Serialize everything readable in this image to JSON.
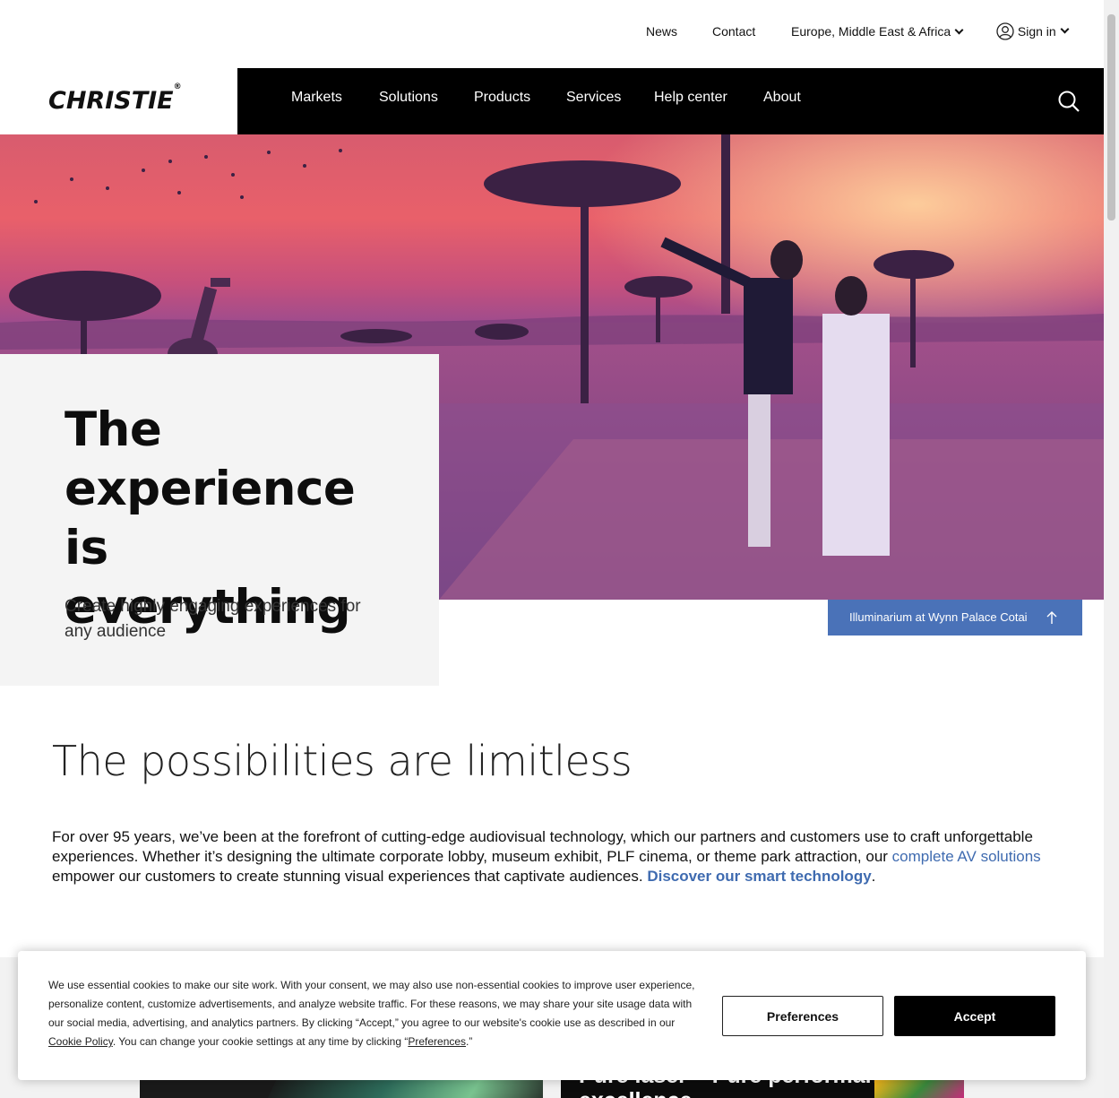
{
  "utility": {
    "news": "News",
    "contact": "Contact",
    "region": "Europe, Middle East & Africa",
    "signin": "Sign in"
  },
  "brand": {
    "logo": "CHRISTIE",
    "reg": "®"
  },
  "nav": {
    "items": [
      "Markets",
      "Solutions",
      "Products",
      "Services",
      "Help center",
      "About"
    ]
  },
  "hero": {
    "title": "The experience is everything",
    "subtitle": "Create highly engaging experiences for any audience",
    "caption": "Illuminarium at Wynn Palace Cotai"
  },
  "intro": {
    "title": "The possibilities are limitless",
    "p1": "For over 95 years, we’ve been at the forefront of cutting-edge audiovisual technology, which our partners and customers use to craft unforgettable experiences. Whether it’s designing the ultimate corporate lobby, museum exhibit, PLF cinema, or theme park attraction, our ",
    "link1": "complete AV solutions",
    "p2": " empower our customers to create stunning visual experiences that captivate audiences. ",
    "link2": "Discover our smart technology",
    "p3": "."
  },
  "cards": {
    "right_title": "Pure laser – Pure performance excellence"
  },
  "cookie": {
    "text1": "We use essential cookies to make our site work. With your consent, we may also use non-essential cookies to improve user experience, personalize content, customize advertisements, and analyze website traffic. For these reasons, we may share your site usage data with our social media, advertising, and analytics partners. By clicking “Accept,” you agree to our website's cookie use as described in our ",
    "policy_link": "Cookie Policy",
    "text2": ". You can change your cookie settings at any time by clicking “",
    "pref_link": "Preferences",
    "text3": ".”",
    "preferences_btn": "Preferences",
    "accept_btn": "Accept"
  },
  "colors": {
    "accent": "#4a72b8",
    "link": "#3f6bb0",
    "nav_bg": "#000000"
  },
  "icons": {
    "user": "user-icon",
    "search": "search-icon",
    "arrow": "arrow-up-icon"
  }
}
